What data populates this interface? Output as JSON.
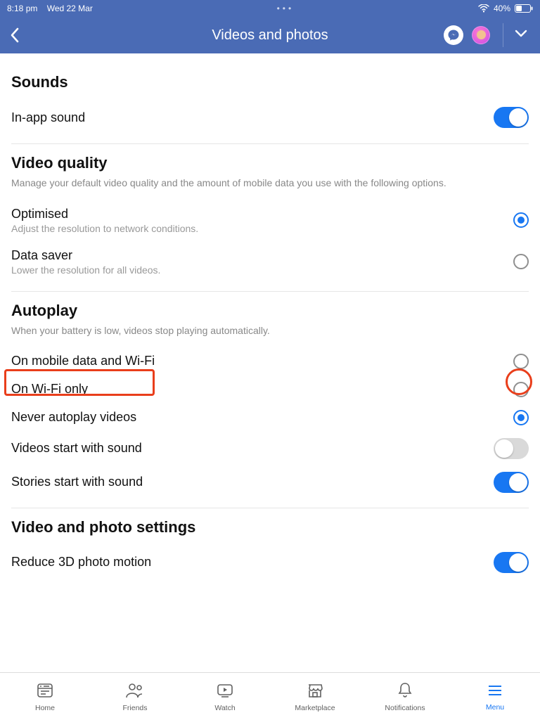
{
  "status": {
    "time": "8:18 pm",
    "date": "Wed 22 Mar",
    "battery": "40%"
  },
  "nav": {
    "title": "Videos and photos"
  },
  "sections": {
    "sounds": {
      "title": "Sounds",
      "inapp_label": "In-app sound"
    },
    "videoQuality": {
      "title": "Video quality",
      "sub": "Manage your default video quality and the amount of mobile data you use with the following options.",
      "optimised_label": "Optimised",
      "optimised_sub": "Adjust the resolution to network conditions.",
      "datasaver_label": "Data saver",
      "datasaver_sub": "Lower the resolution for all videos."
    },
    "autoplay": {
      "title": "Autoplay",
      "sub": "When your battery is low, videos stop playing automatically.",
      "opt1": "On mobile data and Wi-Fi",
      "opt2": "On Wi-Fi only",
      "opt3": "Never autoplay videos",
      "videos_sound": "Videos start with sound",
      "stories_sound": "Stories start with sound"
    },
    "videoPhoto": {
      "title": "Video and photo settings",
      "reduce3d": "Reduce 3D photo motion"
    }
  },
  "tabs": {
    "home": "Home",
    "friends": "Friends",
    "watch": "Watch",
    "marketplace": "Marketplace",
    "notifications": "Notifications",
    "menu": "Menu"
  }
}
